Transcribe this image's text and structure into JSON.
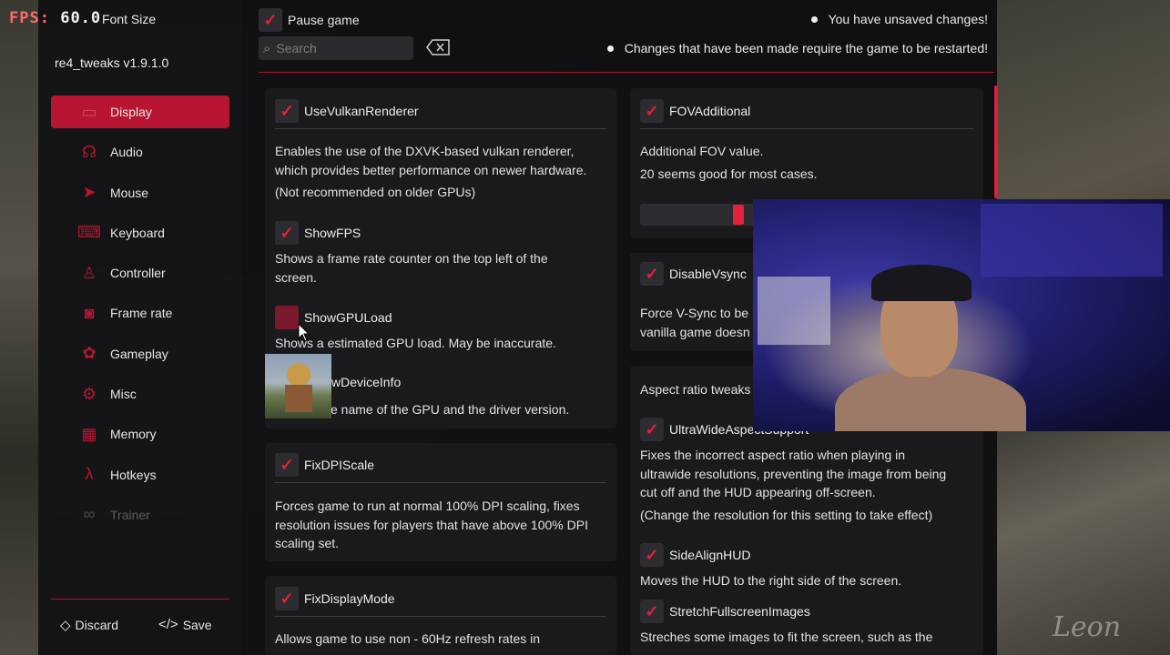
{
  "overlay": {
    "fps_label": "FPS:",
    "fps_value": "60.0",
    "font_size_label": "Font Size"
  },
  "app": {
    "version": "re4_tweaks v1.9.1.0"
  },
  "sidebar": {
    "items": [
      {
        "label": "Display",
        "icon": "display-icon",
        "active": true
      },
      {
        "label": "Audio",
        "icon": "headphones-icon"
      },
      {
        "label": "Mouse",
        "icon": "mouse-pointer-icon"
      },
      {
        "label": "Keyboard",
        "icon": "keyboard-icon"
      },
      {
        "label": "Controller",
        "icon": "controller-icon"
      },
      {
        "label": "Frame rate",
        "icon": "camera-icon"
      },
      {
        "label": "Gameplay",
        "icon": "gameplay-icon"
      },
      {
        "label": "Misc",
        "icon": "gear-icon"
      },
      {
        "label": "Memory",
        "icon": "memory-icon"
      },
      {
        "label": "Hotkeys",
        "icon": "lambda-icon"
      },
      {
        "label": "Trainer",
        "icon": "trainer-icon",
        "disabled": true
      }
    ],
    "discard_label": "Discard",
    "save_label": "Save"
  },
  "header": {
    "pause_game_label": "Pause game",
    "pause_game_checked": true,
    "search_placeholder": "Search",
    "notice_unsaved": "You have unsaved changes!",
    "notice_restart": "Changes that have been made require the game to be restarted!"
  },
  "left_column": {
    "use_vulkan": {
      "label": "UseVulkanRenderer",
      "checked": true,
      "desc1": "Enables the use of the DXVK-based vulkan renderer,",
      "desc2": "which provides better performance on newer hardware.",
      "desc3": "(Not recommended on older GPUs)"
    },
    "show_fps": {
      "label": "ShowFPS",
      "checked": true,
      "desc1": "Shows a frame rate counter on the top left of the",
      "desc2": "screen."
    },
    "show_gpu_load": {
      "label": "ShowGPULoad",
      "checked": false,
      "desc1": "Shows a estimated GPU load. May be inaccurate."
    },
    "show_device_info": {
      "label_fragment": "wDeviceInfo",
      "desc_fragment": "e name of the GPU and the driver version."
    },
    "fix_dpi_scale": {
      "label": "FixDPIScale",
      "checked": true,
      "desc1": "Forces game to run at normal 100% DPI scaling, fixes",
      "desc2": "resolution issues for players that have above 100% DPI",
      "desc3": "scaling set."
    },
    "fix_display_mode": {
      "label": "FixDisplayMode",
      "checked": true,
      "desc1": "Allows game to use non - 60Hz refresh rates in"
    }
  },
  "right_column": {
    "fov_additional": {
      "label": "FOVAdditional",
      "checked": true,
      "desc1": "Additional FOV value.",
      "desc2": "20 seems good for most cases."
    },
    "disable_vsync": {
      "label": "DisableVsync",
      "checked": true,
      "desc1": "Force V-Sync to be",
      "desc2": "vanilla game doesn"
    },
    "aspect_section": {
      "title": "Aspect ratio tweaks"
    },
    "ultrawide": {
      "label_fragment": "UltraWideAspectSupport",
      "checked": true,
      "desc1": "Fixes the incorrect aspect ratio when playing in",
      "desc2": "ultrawide resolutions, preventing the image from being",
      "desc3": "cut off and the HUD appearing off-screen.",
      "desc4": "(Change the resolution for this setting to take effect)"
    },
    "side_align_hud": {
      "label": "SideAlignHUD",
      "checked": true,
      "desc1": "Moves the HUD to the right side of the screen."
    },
    "stretch_fullscreen": {
      "label": "StretchFullscreenImages",
      "checked": true,
      "desc1": "Streches some images to fit the screen, such as the"
    }
  },
  "game_hud": {
    "character_name": "Leon"
  },
  "colors": {
    "accent": "#b71532",
    "check": "#e6203a",
    "panel": "#1a1a1d"
  }
}
